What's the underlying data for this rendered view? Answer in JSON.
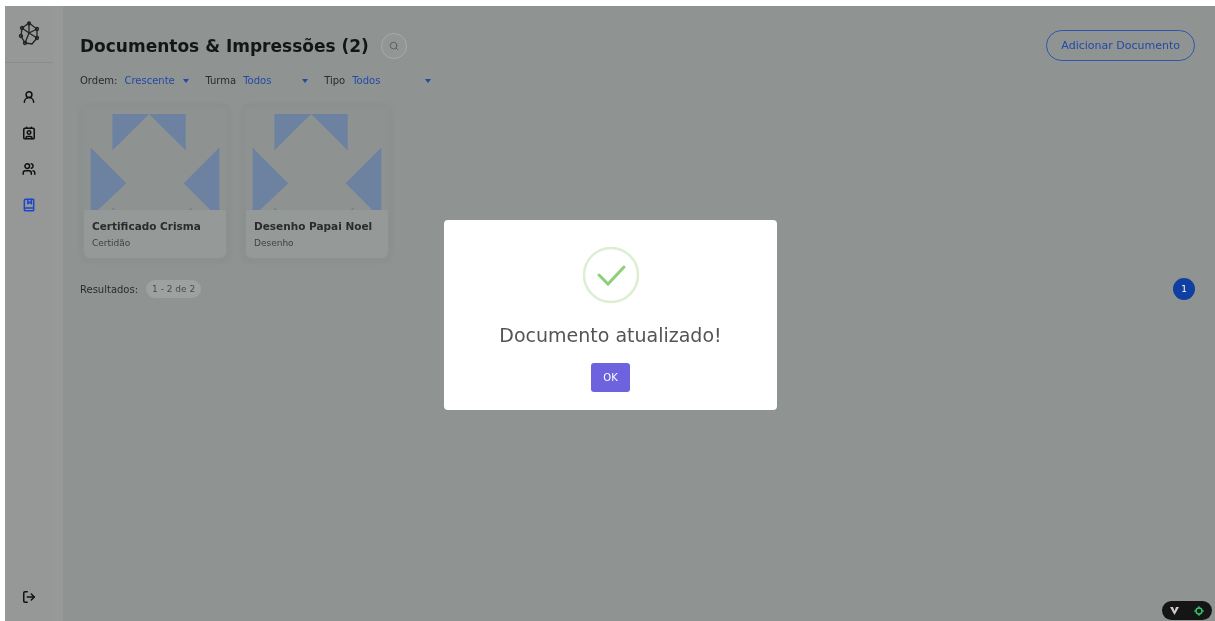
{
  "sidebar": {
    "items": [
      {
        "kind": "person",
        "selected": false
      },
      {
        "kind": "contact",
        "selected": false
      },
      {
        "kind": "group",
        "selected": false
      },
      {
        "kind": "book",
        "selected": true
      }
    ]
  },
  "header": {
    "title": "Documentos & Impressões (2)",
    "add_button": "Adicionar Documento"
  },
  "filters": [
    {
      "label": "Ordem:",
      "value": "Crescente"
    },
    {
      "label": "Turma",
      "value": "Todos"
    },
    {
      "label": "Tipo",
      "value": "Todos"
    }
  ],
  "cards": [
    {
      "title": "Certificado Crisma",
      "subtitle": "Certidão"
    },
    {
      "title": "Desenho Papai Noel",
      "subtitle": "Desenho"
    }
  ],
  "results": {
    "label": "Resultados:",
    "range": "1 - 2 de 2"
  },
  "pagination": [
    {
      "label": "1",
      "selected": true
    }
  ],
  "dialog": {
    "message": "Documento atualizado!",
    "ok": "OK"
  }
}
